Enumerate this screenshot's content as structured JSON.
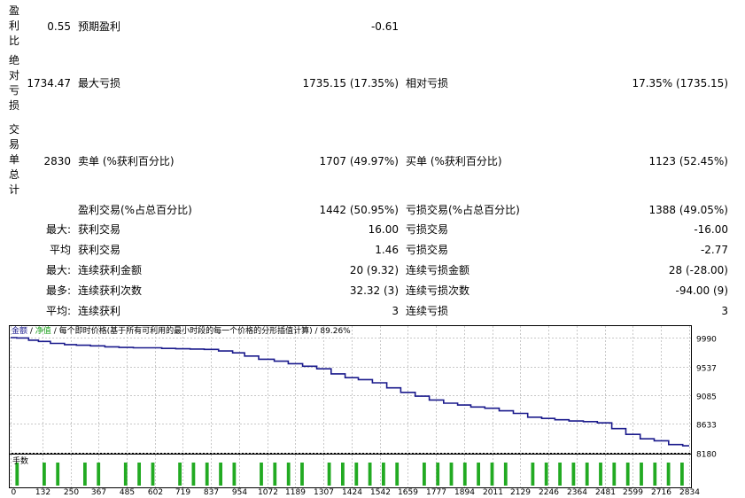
{
  "rows": {
    "profit_factor": {
      "label": "盈利比",
      "value": "0.55",
      "name": "预期盈利",
      "name_value": "-0.61"
    },
    "abs_drawdown": {
      "label": "绝对亏损",
      "value": "1734.47",
      "name": "最大亏损",
      "name_value": "1735.15 (17.35%)",
      "name2": "相对亏损",
      "name2_value": "17.35% (1735.15)"
    },
    "total_trades": {
      "label": "交易单总计",
      "value": "2830",
      "name": "卖单 (%获利百分比)",
      "name_value": "1707 (49.97%)",
      "name2": "买单 (%获利百分比)",
      "name2_value": "1123 (52.45%)"
    },
    "profit_trades": {
      "name": "盈利交易(%占总百分比)",
      "name_value": "1442 (50.95%)",
      "name2": "亏损交易(%占总百分比)",
      "name2_value": "1388 (49.05%)"
    },
    "largest": {
      "prefix": "最大:",
      "name": "获利交易",
      "name_value": "16.00",
      "name2": "亏损交易",
      "name2_value": "-16.00"
    },
    "average": {
      "prefix": "平均",
      "name": "获利交易",
      "name_value": "1.46",
      "name2": "亏损交易",
      "name2_value": "-2.77"
    },
    "max_consec_amount": {
      "prefix": "最大:",
      "name": "连续获利金额",
      "name_value": "20 (9.32)",
      "name2": "连续亏损金额",
      "name2_value": "28 (-28.00)"
    },
    "max_consec_count": {
      "prefix": "最多:",
      "name": "连续获利次数",
      "name_value": "32.32 (3)",
      "name2": "连续亏损次数",
      "name2_value": "-94.00 (9)"
    },
    "avg_consec": {
      "prefix": "平均:",
      "name": "连续获利",
      "name_value": "3",
      "name2": "连续亏损",
      "name2_value": "3"
    }
  },
  "chart_legend": {
    "balance": "金额",
    "equity": "净值",
    "desc": "每个即时价格(基于所有可利用的最小时段的每一个价格的分形插值计算)",
    "quality": "89.26%"
  },
  "volume_label": "手数",
  "colors": {
    "balance": "#1a1a8c",
    "equity": "#1a9e1a",
    "volume": "#22aa22",
    "grid": "#c8c8c8"
  },
  "chart_data": {
    "type": "line",
    "y_ticks": [
      9990,
      9537,
      9085,
      8633,
      8180
    ],
    "ylim": [
      8180,
      9990
    ],
    "x_ticks": [
      0,
      132,
      250,
      367,
      485,
      602,
      719,
      837,
      954,
      1072,
      1189,
      1307,
      1424,
      1542,
      1659,
      1777,
      1894,
      2011,
      2129,
      2246,
      2364,
      2481,
      2599,
      2716,
      2834
    ],
    "xlim": [
      0,
      2834
    ],
    "series": [
      {
        "name": "金额",
        "x": [
          0,
          50,
          100,
          132,
          200,
          250,
          300,
          367,
          420,
          485,
          540,
          602,
          660,
          719,
          780,
          837,
          900,
          954,
          1000,
          1072,
          1130,
          1189,
          1250,
          1307,
          1370,
          1424,
          1480,
          1542,
          1600,
          1659,
          1720,
          1777,
          1840,
          1894,
          1950,
          2011,
          2070,
          2129,
          2190,
          2246,
          2300,
          2364,
          2420,
          2481,
          2540,
          2599,
          2660,
          2716,
          2780,
          2834
        ],
        "y": [
          9990,
          9985,
          9950,
          9930,
          9900,
          9880,
          9870,
          9860,
          9845,
          9835,
          9830,
          9830,
          9820,
          9815,
          9810,
          9805,
          9780,
          9750,
          9700,
          9650,
          9620,
          9580,
          9540,
          9500,
          9420,
          9360,
          9330,
          9280,
          9200,
          9130,
          9070,
          9010,
          8960,
          8930,
          8900,
          8880,
          8840,
          8800,
          8740,
          8720,
          8700,
          8680,
          8670,
          8650,
          8560,
          8470,
          8400,
          8370,
          8310,
          8290
        ]
      }
    ],
    "volume": [
      1,
      0,
      1,
      1,
      0,
      1,
      1,
      0,
      1,
      1,
      1,
      0,
      1,
      1,
      1,
      1,
      1,
      0,
      1,
      1,
      1,
      1,
      0,
      1,
      1,
      1,
      1,
      1,
      1,
      0,
      1,
      1,
      1,
      1,
      1,
      1,
      1,
      0,
      1,
      1,
      1,
      1,
      1,
      1,
      1,
      1,
      1,
      1,
      1,
      1
    ]
  }
}
